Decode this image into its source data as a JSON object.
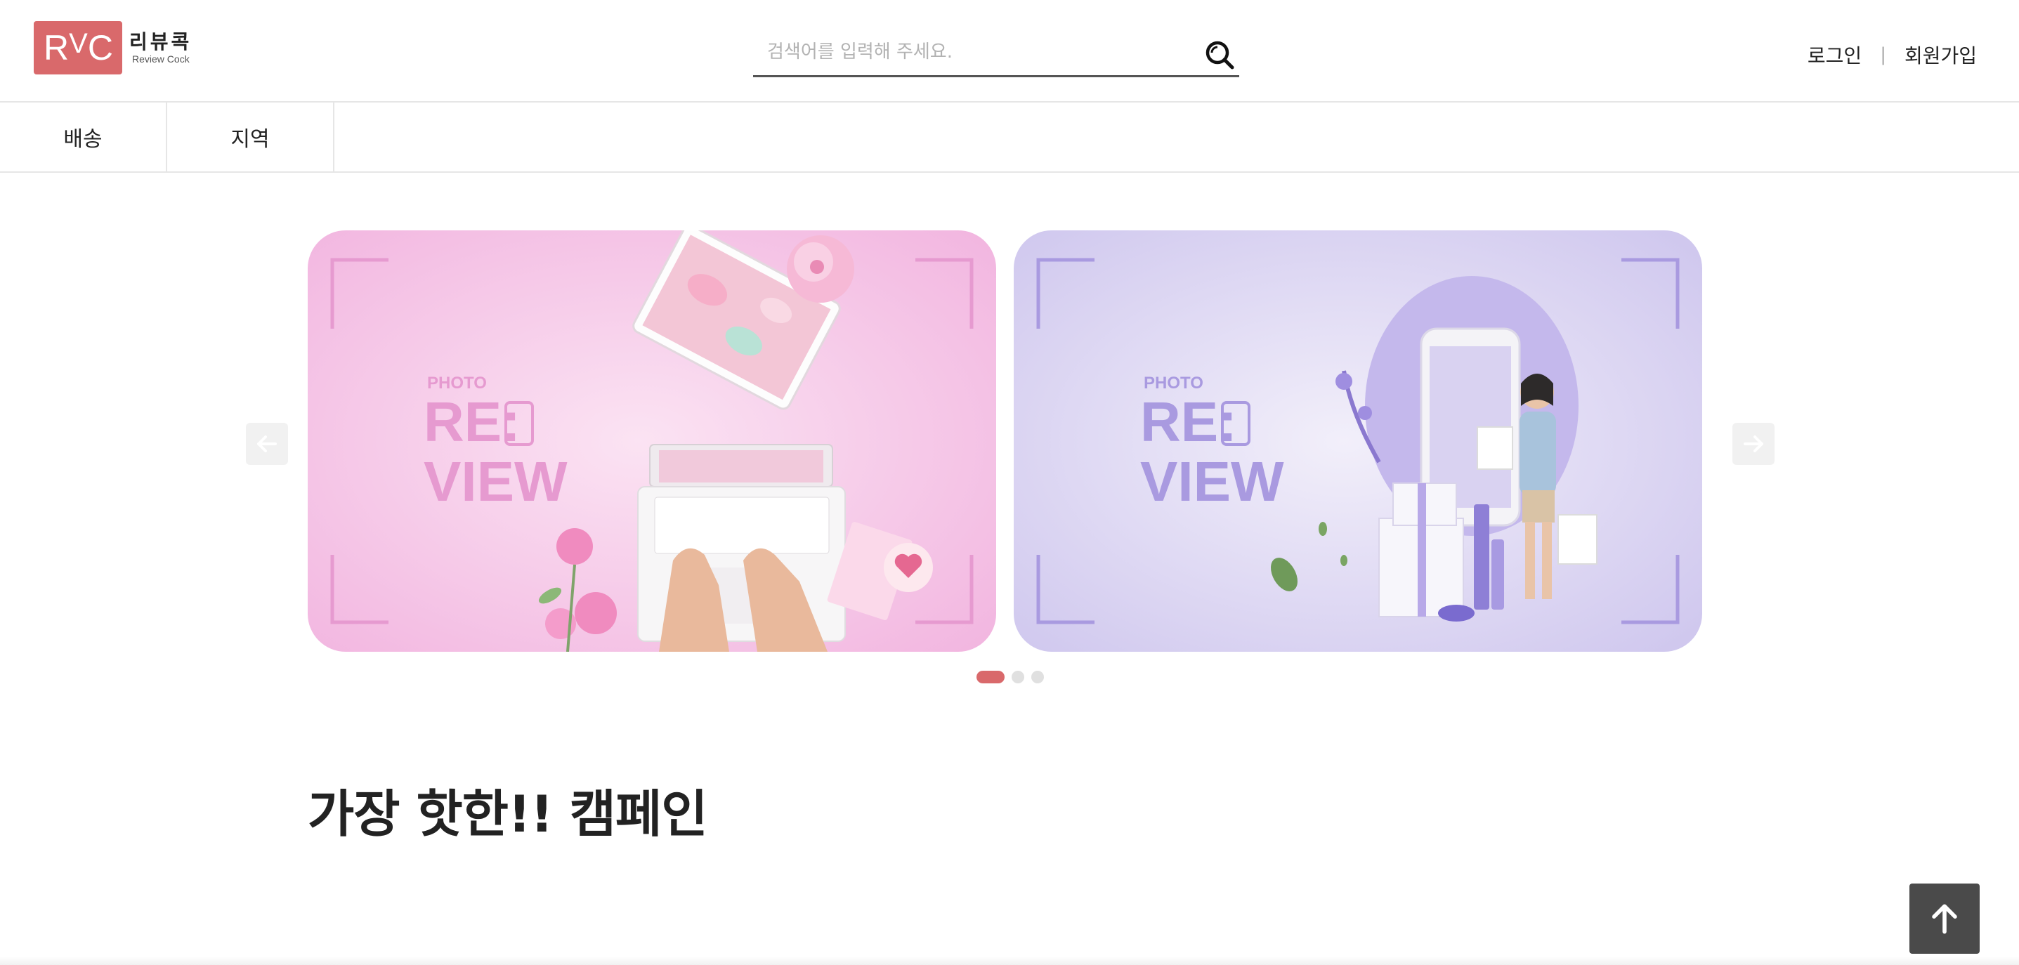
{
  "header": {
    "logo": {
      "mark": "RVC",
      "name_kr": "리뷰콕",
      "name_en": "Review Cock"
    },
    "search": {
      "placeholder": "검색어를 입력해 주세요.",
      "value": ""
    },
    "auth": {
      "login": "로그인",
      "separator": "|",
      "signup": "회원가입"
    }
  },
  "categories": [
    {
      "label": "배송"
    },
    {
      "label": "지역"
    }
  ],
  "carousel": {
    "slides": [
      {
        "photo": "PHOTO",
        "line1": "RE:",
        "line2": "VIEW",
        "theme": "pink",
        "accent": "#e69ad0"
      },
      {
        "photo": "PHOTO",
        "line1": "RE:",
        "line2": "VIEW",
        "theme": "lavender",
        "accent": "#a99ae0"
      }
    ],
    "dots": 3,
    "active_dot": 0,
    "prev_icon": "arrow-left-icon",
    "next_icon": "arrow-right-icon"
  },
  "section": {
    "title": "가장 핫한!! 캠페인"
  },
  "back_to_top_icon": "arrow-up-icon",
  "colors": {
    "brand": "#d9696b",
    "dark_button": "#4a4a4a",
    "divider": "#e6e6e6"
  }
}
